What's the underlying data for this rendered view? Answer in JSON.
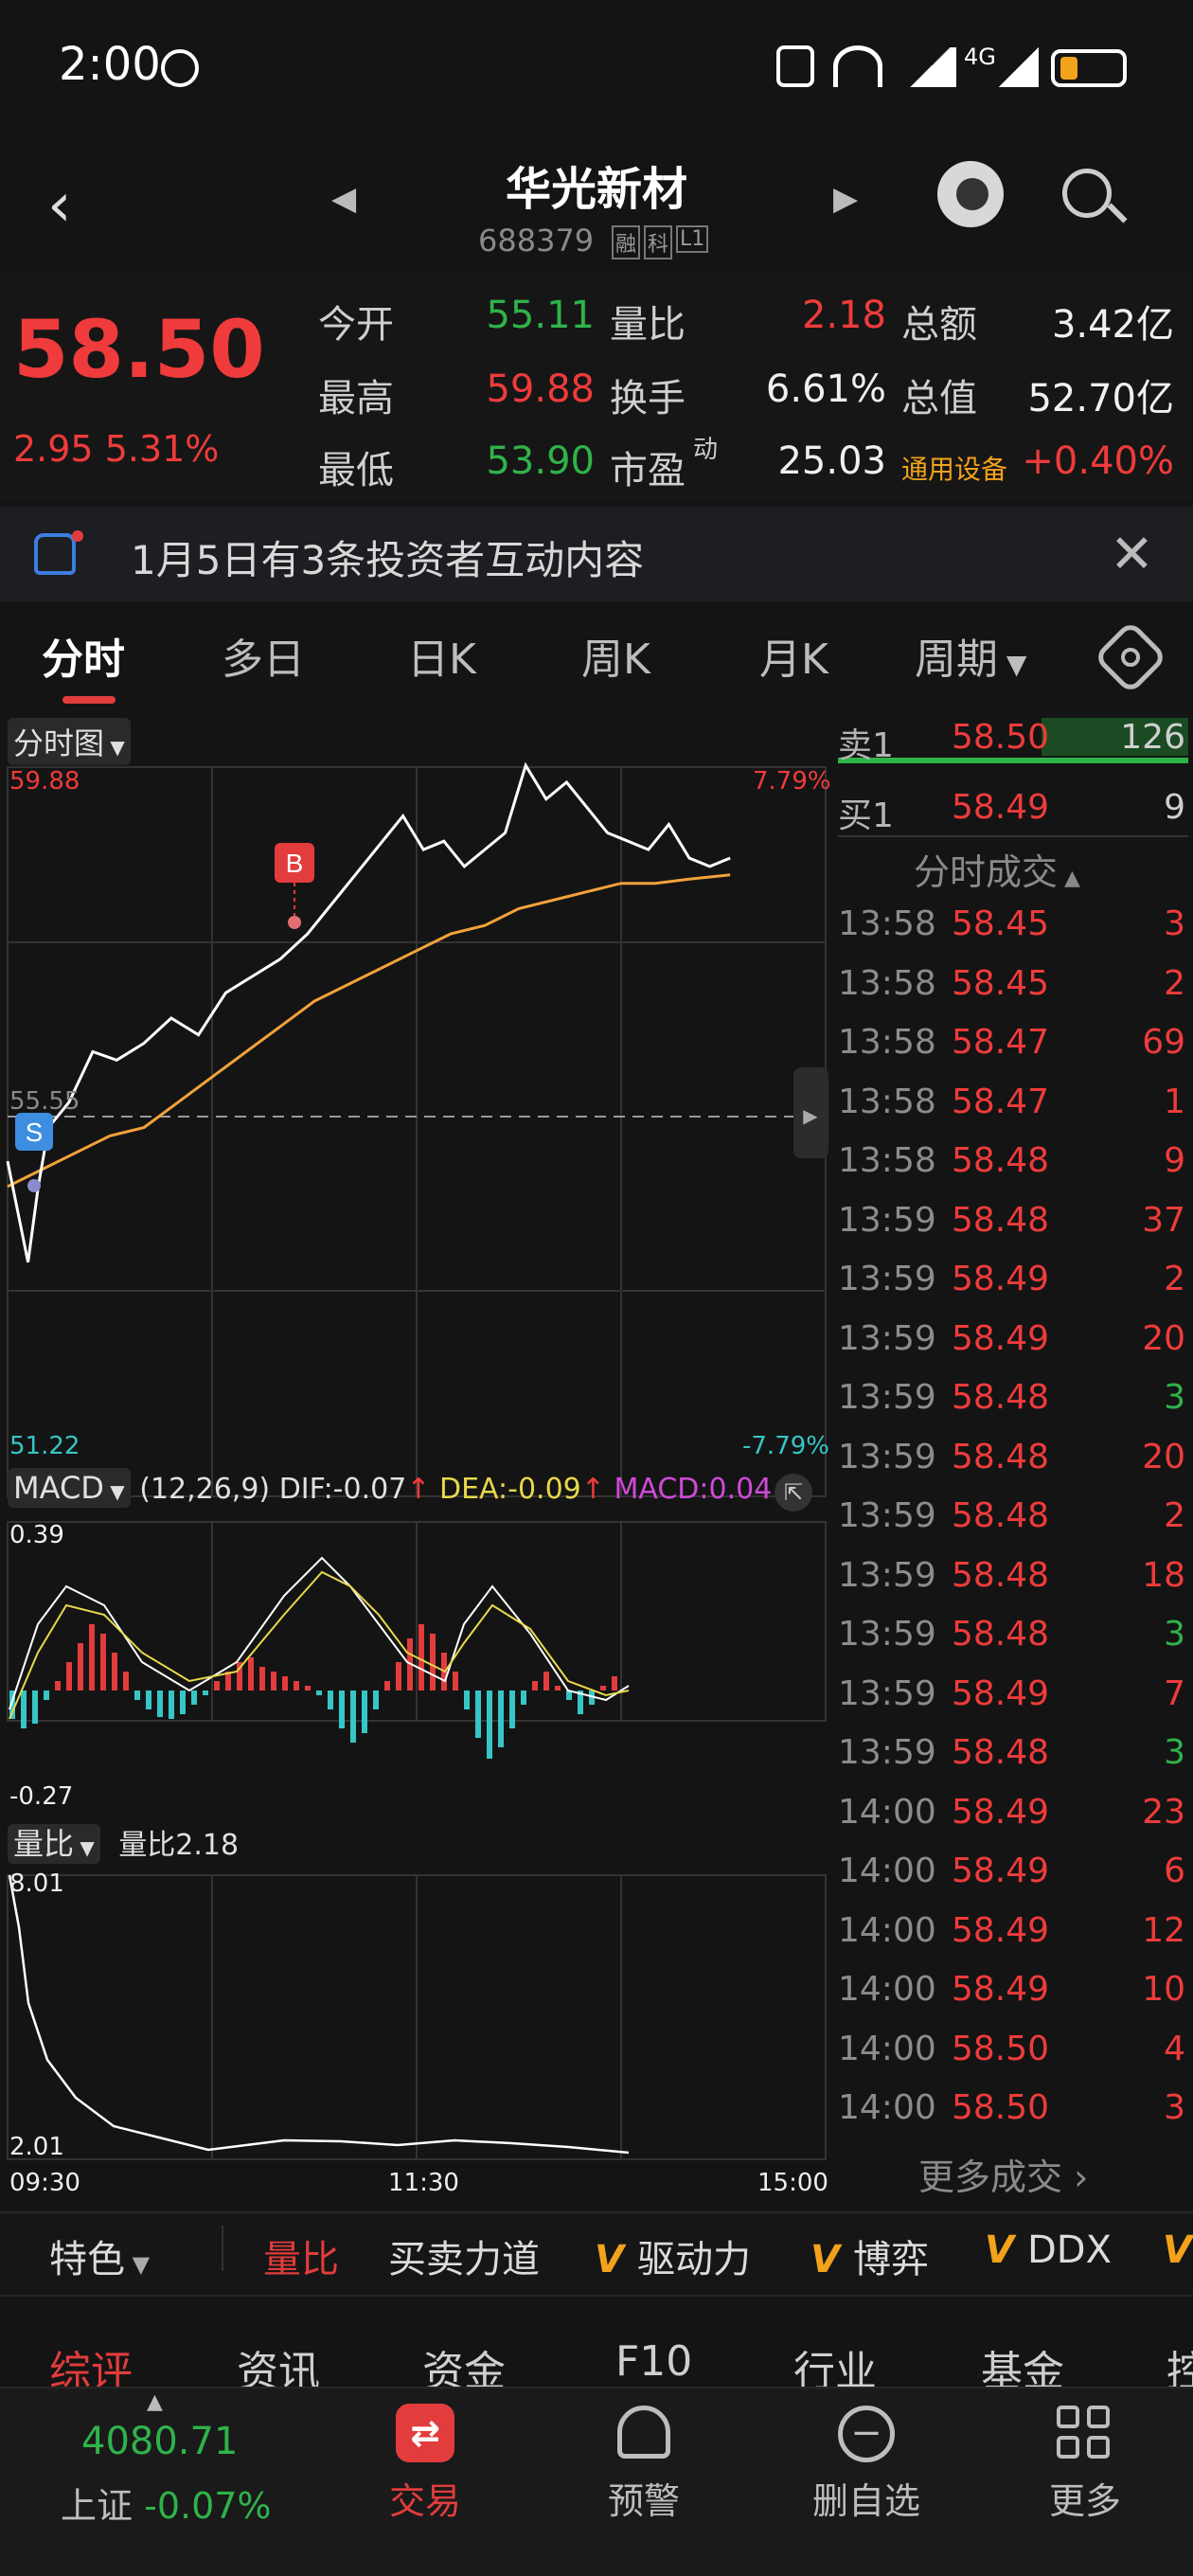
{
  "status_bar": {
    "time": "2:00",
    "network": "4G"
  },
  "header": {
    "title": "华光新材",
    "code": "688379",
    "tags": [
      "融",
      "科",
      "L1"
    ]
  },
  "quote": {
    "price": "58.50",
    "change": "2.95 5.31%",
    "rows": [
      [
        {
          "label": "今开",
          "value": "55.11",
          "color": "green"
        },
        {
          "label": "量比",
          "value": "2.18",
          "color": "red"
        },
        {
          "label": "总额",
          "value": "3.42亿",
          "color": "white"
        }
      ],
      [
        {
          "label": "最高",
          "value": "59.88",
          "color": "red"
        },
        {
          "label": "换手",
          "value": "6.61%",
          "color": "white"
        },
        {
          "label": "总值",
          "value": "52.70亿",
          "color": "white"
        }
      ],
      [
        {
          "label": "最低",
          "value": "53.90",
          "color": "green"
        },
        {
          "label": "市盈",
          "sup": "动",
          "value": "25.03",
          "color": "white"
        },
        {
          "label": "通用设备",
          "value": "+0.40%",
          "color": "red"
        }
      ]
    ]
  },
  "notice": {
    "text": "1月5日有3条投资者互动内容"
  },
  "tabs": {
    "items": [
      "分时",
      "多日",
      "日K",
      "周K",
      "月K",
      "周期"
    ],
    "active": "分时"
  },
  "chart": {
    "selector": "分时图",
    "price_high": "59.88",
    "price_low": "51.22",
    "pct_high": "7.79%",
    "pct_low": "-7.79%",
    "prev_close": "55.55",
    "marker_buy": "B",
    "marker_sell": "S",
    "macd": {
      "selector": "MACD",
      "params": "(12,26,9)",
      "dif": "DIF:-0.07",
      "dea": "DEA:-0.09",
      "macd": "MACD:0.04",
      "top": "0.39",
      "bottom": "-0.27"
    },
    "volratio": {
      "selector": "量比",
      "label": "量比2.18",
      "top": "8.01",
      "bottom": "2.01"
    },
    "x_labels": [
      "09:30",
      "11:30",
      "15:00"
    ],
    "colors": {
      "price": "#ffffff",
      "avg": "#f2a23a",
      "up": "#e23c3c",
      "down": "#36c6c6"
    }
  },
  "order_book": {
    "ask": {
      "label": "卖1",
      "price": "58.50",
      "vol": "126"
    },
    "bid": {
      "label": "买1",
      "price": "58.49",
      "vol": "9"
    },
    "title": "分时成交",
    "trades": [
      {
        "time": "13:58",
        "price": "58.45",
        "vol": "3",
        "dir": "up"
      },
      {
        "time": "13:58",
        "price": "58.45",
        "vol": "2",
        "dir": "up"
      },
      {
        "time": "13:58",
        "price": "58.47",
        "vol": "69",
        "dir": "up"
      },
      {
        "time": "13:58",
        "price": "58.47",
        "vol": "1",
        "dir": "up"
      },
      {
        "time": "13:58",
        "price": "58.48",
        "vol": "9",
        "dir": "up"
      },
      {
        "time": "13:59",
        "price": "58.48",
        "vol": "37",
        "dir": "up"
      },
      {
        "time": "13:59",
        "price": "58.49",
        "vol": "2",
        "dir": "up"
      },
      {
        "time": "13:59",
        "price": "58.49",
        "vol": "20",
        "dir": "up"
      },
      {
        "time": "13:59",
        "price": "58.48",
        "vol": "3",
        "dir": "down"
      },
      {
        "time": "13:59",
        "price": "58.48",
        "vol": "20",
        "dir": "up"
      },
      {
        "time": "13:59",
        "price": "58.48",
        "vol": "2",
        "dir": "up"
      },
      {
        "time": "13:59",
        "price": "58.48",
        "vol": "18",
        "dir": "up"
      },
      {
        "time": "13:59",
        "price": "58.48",
        "vol": "3",
        "dir": "down"
      },
      {
        "time": "13:59",
        "price": "58.49",
        "vol": "7",
        "dir": "up"
      },
      {
        "time": "13:59",
        "price": "58.48",
        "vol": "3",
        "dir": "down"
      },
      {
        "time": "14:00",
        "price": "58.49",
        "vol": "23",
        "dir": "up"
      },
      {
        "time": "14:00",
        "price": "58.49",
        "vol": "6",
        "dir": "up"
      },
      {
        "time": "14:00",
        "price": "58.49",
        "vol": "12",
        "dir": "up"
      },
      {
        "time": "14:00",
        "price": "58.49",
        "vol": "10",
        "dir": "up"
      },
      {
        "time": "14:00",
        "price": "58.50",
        "vol": "4",
        "dir": "up"
      },
      {
        "time": "14:00",
        "price": "58.50",
        "vol": "3",
        "dir": "up"
      }
    ],
    "more": "更多成交 ›"
  },
  "indicator_bar": {
    "feature": "特色",
    "items": [
      "量比",
      "买卖力道",
      "驱动力",
      "博弈",
      "DDX"
    ],
    "v_items": [
      false,
      false,
      true,
      true,
      true
    ],
    "v_mark": "V"
  },
  "info_tabs": [
    "综评",
    "资讯",
    "资金",
    "F10",
    "行业",
    "基金",
    "控"
  ],
  "index": {
    "value": "4080.71",
    "name": "上证",
    "change": "-0.07%"
  },
  "bottom_nav": [
    "交易",
    "预警",
    "删自选",
    "更多"
  ]
}
